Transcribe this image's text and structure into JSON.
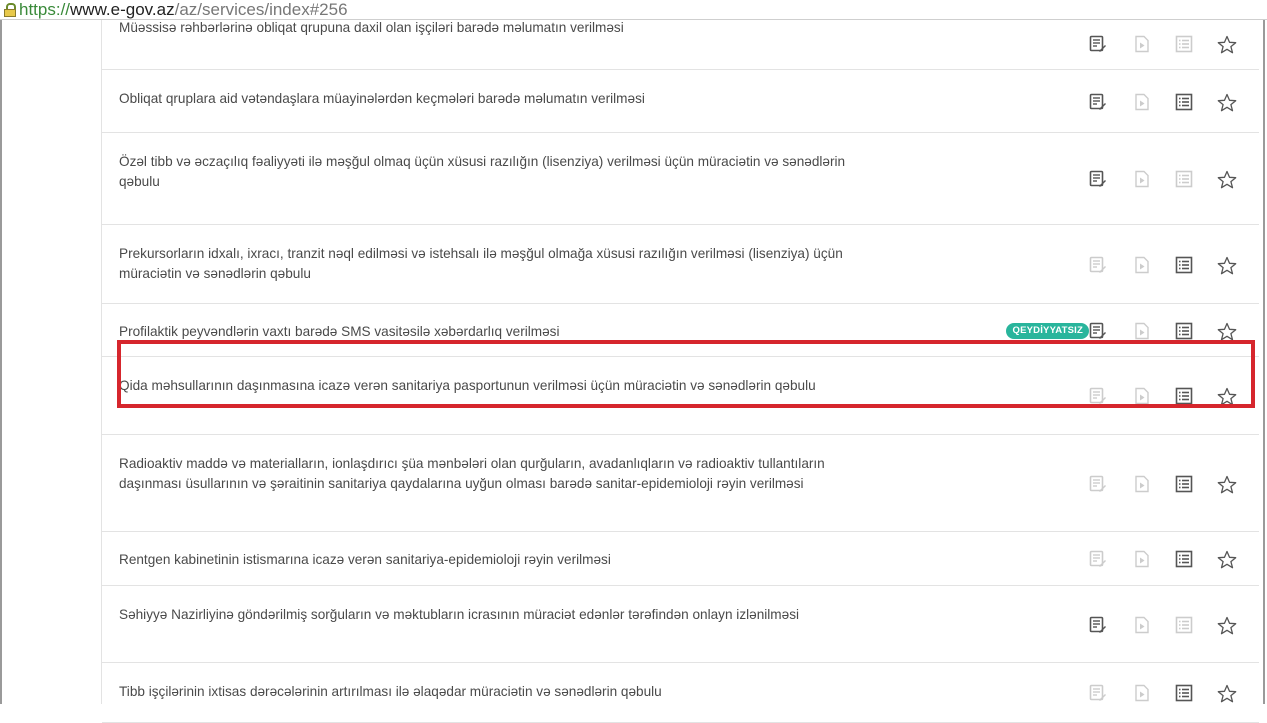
{
  "browser": {
    "url_scheme": "https://",
    "url_host": "www.e-gov.az",
    "url_path": "/az/services/index#256"
  },
  "services": [
    {
      "title": "Müəssisə rəhbərlərinə obliqat qrupuna daxil olan işçiləri barədə məlumatın verilməsi",
      "badge": "",
      "icons": [
        "active",
        "inactive",
        "inactive",
        "active"
      ]
    },
    {
      "title": "Obliqat qruplara aid vətəndaşlara müayinələrdən keçmələri barədə məlumatın verilməsi",
      "badge": "",
      "icons": [
        "active",
        "inactive",
        "active",
        "active"
      ]
    },
    {
      "title": "Özəl tibb və əczaçılıq fəaliyyəti ilə məşğul olmaq üçün xüsusi razılığın (lisenziya) verilməsi üçün müraciətin və sənədlərin qəbulu",
      "badge": "",
      "icons": [
        "active",
        "inactive",
        "inactive",
        "active"
      ]
    },
    {
      "title": "Prekursorların idxalı, ixracı, tranzit nəql edilməsi və istehsalı ilə məşğul olmağa xüsusi razılığın verilməsi (lisenziya) üçün müraciətin və sənədlərin qəbulu",
      "badge": "",
      "icons": [
        "inactive",
        "inactive",
        "active",
        "active"
      ]
    },
    {
      "title": "Profilaktik peyvəndlərin vaxtı barədə SMS vasitəsilə xəbərdarlıq verilməsi",
      "badge": "QEYDİYYATSIZ",
      "icons": [
        "active",
        "inactive",
        "active",
        "active"
      ]
    },
    {
      "title": "Qida məhsullarının daşınmasına icazə verən sanitariya pasportunun verilməsi üçün müraciətin və sənədlərin qəbulu",
      "badge": "",
      "icons": [
        "inactive",
        "inactive",
        "active",
        "active"
      ]
    },
    {
      "title": "Radioaktiv maddə və materialların, ionlaşdırıcı şüa mənbələri olan qurğuların, avadanlıqların və radioaktiv tullantıların daşınması üsullarının və şəraitinin sanitariya qaydalarına uyğun olması barədə sanitar-epidemioloji rəyin verilməsi",
      "badge": "",
      "icons": [
        "inactive",
        "inactive",
        "active",
        "active"
      ]
    },
    {
      "title": "Rentgen kabinetinin istismarına icazə verən sanitariya-epidemioloji rəyin verilməsi",
      "badge": "",
      "icons": [
        "inactive",
        "inactive",
        "active",
        "active"
      ]
    },
    {
      "title": "Səhiyyə Nazirliyinə göndərilmiş sorğuların və məktubların icrasının müraciət edənlər tərəfindən onlayn izlənilməsi",
      "badge": "",
      "icons": [
        "active",
        "inactive",
        "inactive",
        "active"
      ]
    },
    {
      "title": "Tibb işçilərinin ixtisas dərəcələrinin artırılması ilə əlaqədar müraciətin və sənədlərin qəbulu",
      "badge": "",
      "icons": [
        "inactive",
        "inactive",
        "active",
        "active"
      ]
    }
  ],
  "icon_names": [
    "e-service-icon",
    "video-guide-icon",
    "description-list-icon",
    "favorite-star-icon"
  ],
  "colors": {
    "active_icon": "#555555",
    "inactive_icon": "#cccccc",
    "badge": "#29b59c",
    "highlight": "#d6262d"
  }
}
